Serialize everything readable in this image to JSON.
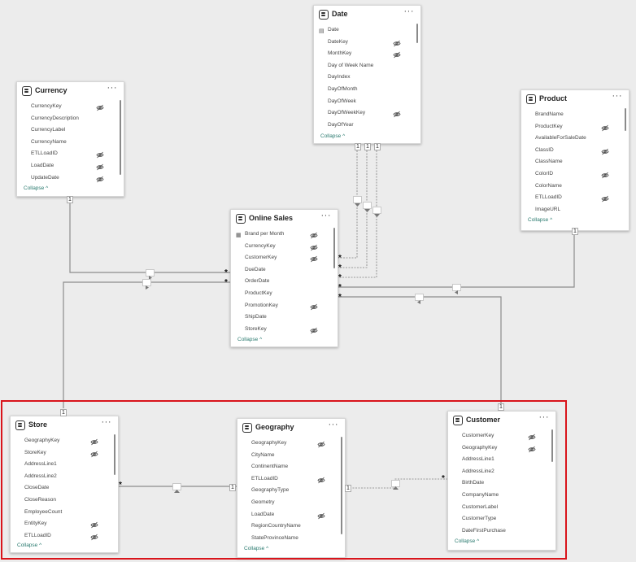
{
  "tables": {
    "date": {
      "title": "Date",
      "more": "···",
      "collapse": "Collapse",
      "fields": [
        {
          "name": "Date",
          "hidden": false,
          "icon": "calendar-icon"
        },
        {
          "name": "DateKey",
          "hidden": true
        },
        {
          "name": "MonthKey",
          "hidden": true
        },
        {
          "name": "Day of Week Name",
          "hidden": false
        },
        {
          "name": "DayIndex",
          "hidden": false
        },
        {
          "name": "DayOfMonth",
          "hidden": false
        },
        {
          "name": "DayOfWeek",
          "hidden": false
        },
        {
          "name": "DayOfWeekKey",
          "hidden": true
        },
        {
          "name": "DayOfYear",
          "hidden": false
        }
      ]
    },
    "currency": {
      "title": "Currency",
      "more": "···",
      "collapse": "Collapse",
      "fields": [
        {
          "name": "CurrencyKey",
          "hidden": true
        },
        {
          "name": "CurrencyDescription",
          "hidden": false
        },
        {
          "name": "CurrencyLabel",
          "hidden": false
        },
        {
          "name": "CurrencyName",
          "hidden": false
        },
        {
          "name": "ETLLoadID",
          "hidden": true
        },
        {
          "name": "LoadDate",
          "hidden": true
        },
        {
          "name": "UpdateDate",
          "hidden": true
        }
      ]
    },
    "product": {
      "title": "Product",
      "more": "···",
      "collapse": "Collapse",
      "fields": [
        {
          "name": "BrandName",
          "hidden": false
        },
        {
          "name": "ProductKey",
          "hidden": true
        },
        {
          "name": "AvailableForSaleDate",
          "hidden": false
        },
        {
          "name": "ClassID",
          "hidden": true
        },
        {
          "name": "ClassName",
          "hidden": false
        },
        {
          "name": "ColorID",
          "hidden": true
        },
        {
          "name": "ColorName",
          "hidden": false
        },
        {
          "name": "ETLLoadID",
          "hidden": true
        },
        {
          "name": "ImageURL",
          "hidden": false
        }
      ]
    },
    "online_sales": {
      "title": "Online Sales",
      "more": "···",
      "collapse": "Collapse",
      "fields": [
        {
          "name": "Brand per Month",
          "hidden": true,
          "icon": "measure-icon"
        },
        {
          "name": "CurrencyKey",
          "hidden": true
        },
        {
          "name": "CustomerKey",
          "hidden": true
        },
        {
          "name": "DueDate",
          "hidden": false
        },
        {
          "name": "OrderDate",
          "hidden": false
        },
        {
          "name": "ProductKey",
          "hidden": false
        },
        {
          "name": "PromotionKey",
          "hidden": true
        },
        {
          "name": "ShipDate",
          "hidden": false
        },
        {
          "name": "StoreKey",
          "hidden": true
        }
      ]
    },
    "store": {
      "title": "Store",
      "more": "···",
      "collapse": "Collapse",
      "fields": [
        {
          "name": "GeographyKey",
          "hidden": true
        },
        {
          "name": "StoreKey",
          "hidden": true
        },
        {
          "name": "AddressLine1",
          "hidden": false
        },
        {
          "name": "AddressLine2",
          "hidden": false
        },
        {
          "name": "CloseDate",
          "hidden": false
        },
        {
          "name": "CloseReason",
          "hidden": false
        },
        {
          "name": "EmployeeCount",
          "hidden": false
        },
        {
          "name": "EntityKey",
          "hidden": true
        },
        {
          "name": "ETLLoadID",
          "hidden": true
        }
      ]
    },
    "geography": {
      "title": "Geography",
      "more": "···",
      "collapse": "Collapse",
      "fields": [
        {
          "name": "GeographyKey",
          "hidden": true
        },
        {
          "name": "CityName",
          "hidden": false
        },
        {
          "name": "ContinentName",
          "hidden": false
        },
        {
          "name": "ETLLoadID",
          "hidden": true
        },
        {
          "name": "GeographyType",
          "hidden": false
        },
        {
          "name": "Geometry",
          "hidden": false
        },
        {
          "name": "LoadDate",
          "hidden": true
        },
        {
          "name": "RegionCountryName",
          "hidden": false
        },
        {
          "name": "StateProvinceName",
          "hidden": false
        }
      ]
    },
    "customer": {
      "title": "Customer",
      "more": "···",
      "collapse": "Collapse",
      "fields": [
        {
          "name": "CustomerKey",
          "hidden": true
        },
        {
          "name": "GeographyKey",
          "hidden": true
        },
        {
          "name": "AddressLine1",
          "hidden": false
        },
        {
          "name": "AddressLine2",
          "hidden": false
        },
        {
          "name": "BirthDate",
          "hidden": false
        },
        {
          "name": "CompanyName",
          "hidden": false
        },
        {
          "name": "CustomerLabel",
          "hidden": false
        },
        {
          "name": "CustomerType",
          "hidden": false
        },
        {
          "name": "DateFirstPurchase",
          "hidden": false
        }
      ]
    }
  },
  "cardinality": {
    "one": "1",
    "many": "*"
  },
  "colors": {
    "selection": "#d9141b",
    "collapse_link": "#2a7a6f",
    "line": "#8c8c8c"
  }
}
